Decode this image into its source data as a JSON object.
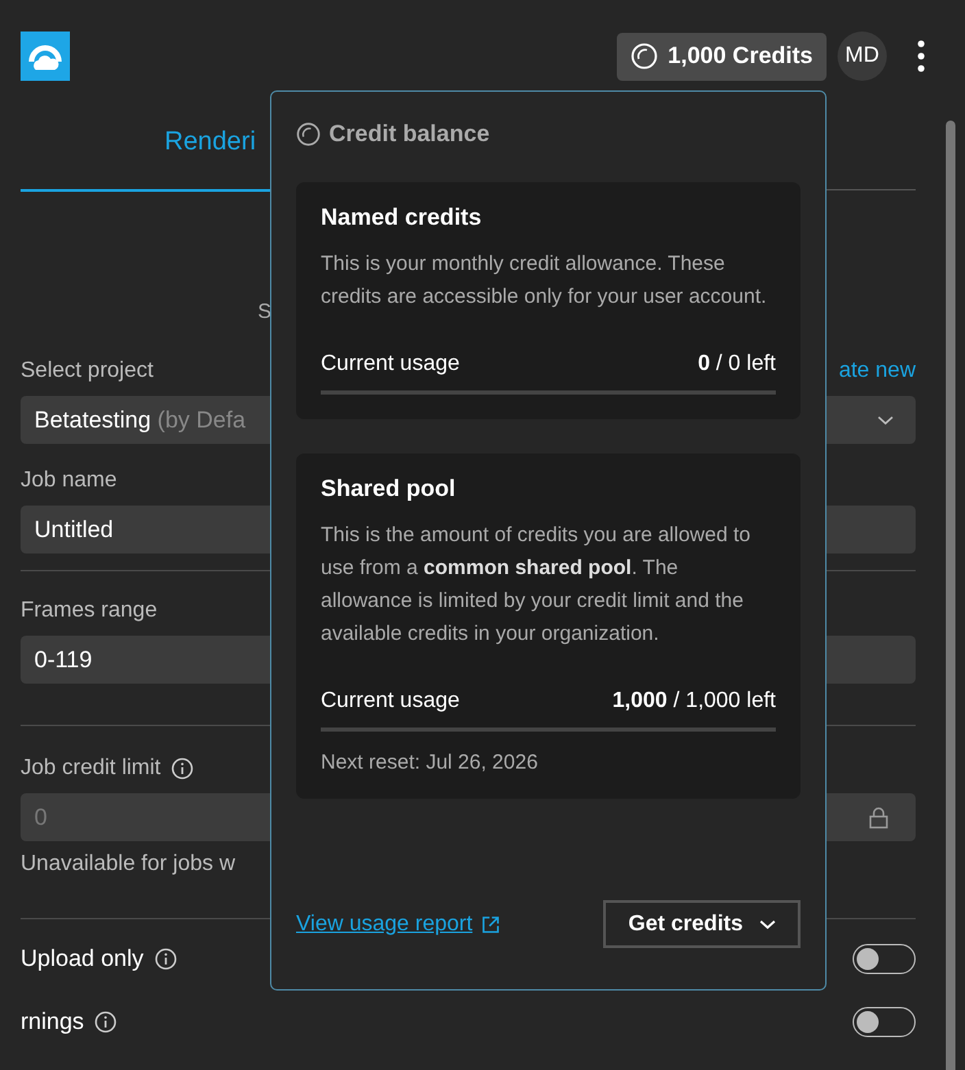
{
  "header": {
    "credits_button": "1,000 Credits",
    "avatar": "MD"
  },
  "tabs": [
    {
      "label": "Renderi",
      "selected": true
    }
  ],
  "cut_text": "S",
  "form": {
    "project": {
      "label": "Select project",
      "link": "ate new",
      "value": "Betatesting",
      "hint": "(by Defa"
    },
    "job_name": {
      "label": "Job name",
      "value": "Untitled"
    },
    "frames": {
      "label": "Frames range",
      "value": "0-119"
    },
    "credit_limit": {
      "label": "Job credit limit",
      "value": "0",
      "disabled": true,
      "note": "Unavailable for jobs w"
    },
    "toggles": [
      {
        "label": "Upload only",
        "on": false
      },
      {
        "label": "rnings",
        "on": false
      }
    ]
  },
  "popover": {
    "title": "Credit balance",
    "cards": [
      {
        "title": "Named credits",
        "text": "This is your monthly credit allowance. These credits are accessible only for your user account.",
        "usage_label": "Current usage",
        "usage": "**0** / 0 left",
        "level": 0
      },
      {
        "title": "Shared pool",
        "text": "This is the amount of credits you are allowed to use from a **common shared pool**. The allowance is limited by your credit limit and the available credits in your organization.",
        "usage_label": "Current usage",
        "usage": "**1,000** / 1,000 left",
        "level": 0,
        "reset": "Next reset: Jul 26, 2026"
      }
    ],
    "link": "View usage report",
    "button": "Get credits"
  }
}
